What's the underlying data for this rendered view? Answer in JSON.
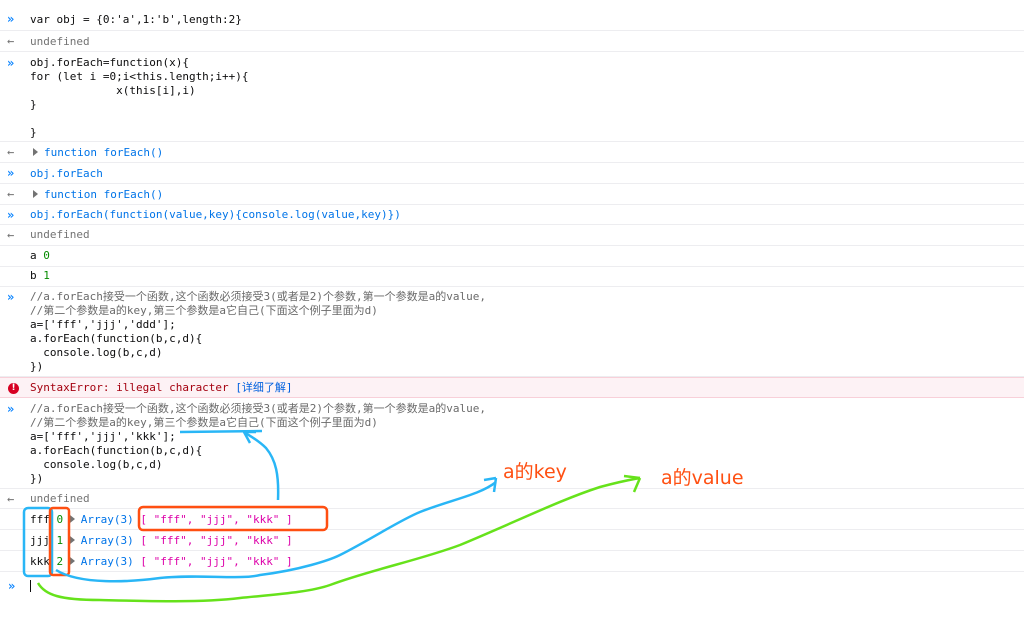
{
  "console": {
    "entries": [
      {
        "lines": [
          "var obj = {0:'a',1:'b',length:2}"
        ]
      },
      {
        "lines": [
          "undefined"
        ]
      },
      {
        "lines": [
          "obj.forEach=function(x){",
          "for (let i =0;i<this.length;i++){",
          "             x(this[i],i)",
          "}",
          "",
          "}"
        ]
      },
      {
        "lines": [
          "function forEach()"
        ]
      },
      {
        "lines": [
          "obj.forEach"
        ]
      },
      {
        "lines": [
          "function forEach()"
        ]
      },
      {
        "lines": [
          "obj.forEach(function(value,key){console.log(value,key)})"
        ]
      },
      {
        "lines": [
          "undefined"
        ]
      },
      {
        "parts": [
          "a",
          "0"
        ]
      },
      {
        "parts": [
          "b",
          "1"
        ]
      },
      {
        "lines": [
          "//a.forEach接受一个函数,这个函数必须接受3(或者是2)个参数,第一个参数是a的value,",
          "//第二个参数是a的key,第三个参数是a它自己(下面这个例子里面为d)",
          "a=['fff','jjj','ddd'];",
          "a.forEach(function(b,c,d){",
          "  console.log(b,c,d)",
          "})"
        ]
      },
      {
        "message": "SyntaxError: illegal character",
        "link": "[详细了解]"
      },
      {
        "lines": [
          "//a.forEach接受一个函数,这个函数必须接受3(或者是2)个参数,第一个参数是a的value,",
          "//第二个参数是a的key,第三个参数是a它自己(下面这个例子里面为d)",
          "a=['fff','jjj','kkk'];",
          "a.forEach(function(b,c,d){",
          "  console.log(b,c,d)",
          "})"
        ]
      },
      {
        "lines": [
          "undefined"
        ]
      },
      {
        "value": "fff",
        "key": "0",
        "type": "Array(3)",
        "array": "[ \"fff\", \"jjj\", \"kkk\" ]"
      },
      {
        "value": "jjj",
        "key": "1",
        "type": "Array(3)",
        "array": "[ \"fff\", \"jjj\", \"kkk\" ]"
      },
      {
        "value": "kkk",
        "key": "2",
        "type": "Array(3)",
        "array": "[ \"fff\", \"jjj\", \"kkk\" ]"
      }
    ],
    "glyphs": {
      "input": "»",
      "output": "←",
      "error": "!"
    },
    "prompt": "»"
  },
  "annotations": {
    "key_label": "a的key",
    "value_label": "a的value",
    "colors": {
      "cyan": "#29b6f6",
      "red": "#ff4f11",
      "green": "#66e21b"
    }
  }
}
